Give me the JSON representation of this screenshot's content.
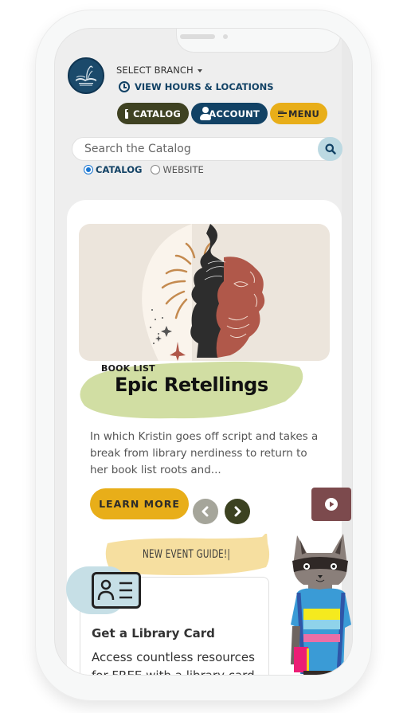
{
  "header": {
    "select_branch": "SELECT BRANCH",
    "hours_link": "VIEW HOURS & LOCATIONS",
    "buttons": {
      "catalog": "CATALOG",
      "account": "ACCOUNT",
      "menu": "MENU"
    }
  },
  "search": {
    "placeholder": "Search the Catalog",
    "value": "",
    "scope_options": [
      {
        "label": "CATALOG",
        "selected": true
      },
      {
        "label": "WEBSITE",
        "selected": false
      }
    ]
  },
  "feature": {
    "eyebrow": "BOOK LIST",
    "title": "Epic Retellings",
    "description": "In which Kristin goes off script and takes a break from library nerdiness to return to her book list roots and...",
    "cta": "LEARN MORE",
    "colors": {
      "accent": "#e8ae19",
      "blob": "#d1dea3",
      "hero_bg": "#ece5dc"
    }
  },
  "promo": {
    "bubble_text": "NEW EVENT GUIDE!|"
  },
  "library_card": {
    "title": "Get a Library Card",
    "text": "Access countless resources for FREE with a library card."
  },
  "icons": {
    "logo": "library-logo",
    "clock": "clock-icon",
    "search": "search-icon",
    "play": "play-icon",
    "id_card": "id-card-icon"
  }
}
